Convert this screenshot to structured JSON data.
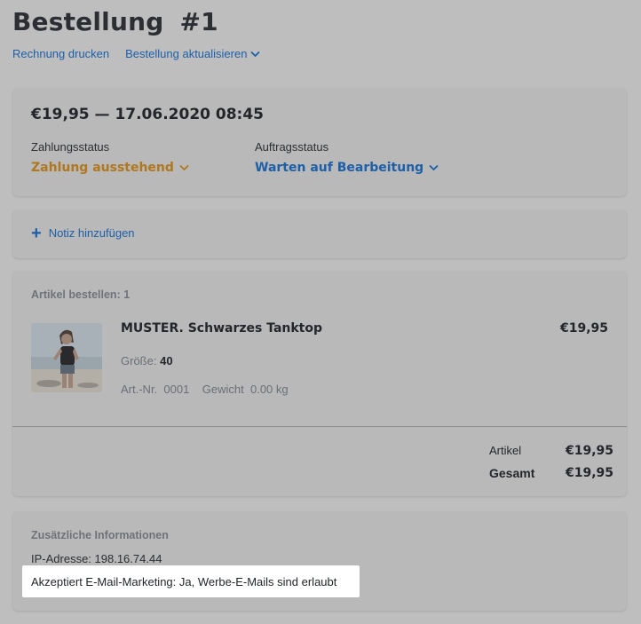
{
  "header": {
    "title_word": "Bestellung",
    "title_number": "#1",
    "links": [
      {
        "label": "Rechnung drucken"
      },
      {
        "label": "Bestellung aktualisieren"
      }
    ]
  },
  "summary": {
    "amount_datetime": "€19,95 — 17.06.2020 08:45",
    "payment_status_label": "Zahlungsstatus",
    "payment_status_value": "Zahlung ausstehend",
    "order_status_label": "Auftragsstatus",
    "order_status_value": "Warten auf Bearbeitung"
  },
  "note": {
    "label": "Notiz hinzufügen"
  },
  "items": {
    "header": "Artikel bestellen: 1",
    "product": {
      "name": "MUSTER. Schwarzes Tanktop",
      "price": "€19,95",
      "size_label": "Größe:",
      "size_value": "40",
      "sku_label": "Art.-Nr.",
      "sku_value": "0001",
      "weight_label": "Gewicht",
      "weight_value": "0.00 kg"
    },
    "totals": {
      "items_label": "Artikel",
      "items_value": "€19,95",
      "total_label": "Gesamt",
      "total_value": "€19,95"
    }
  },
  "additional": {
    "header": "Zusätzliche Informationen",
    "ip_line": "IP-Adresse: 198.16.74.44",
    "marketing_line": "Akzeptiert E-Mail-Marketing: Ja, Werbe-E-Mails sind erlaubt"
  },
  "colors": {
    "accent_blue": "#1d5fa8",
    "pending_orange": "#b0771d",
    "overlay_gray": "#bebebe"
  },
  "icons": [
    "chevron-down-icon",
    "plus-icon",
    "product-thumbnail"
  ]
}
